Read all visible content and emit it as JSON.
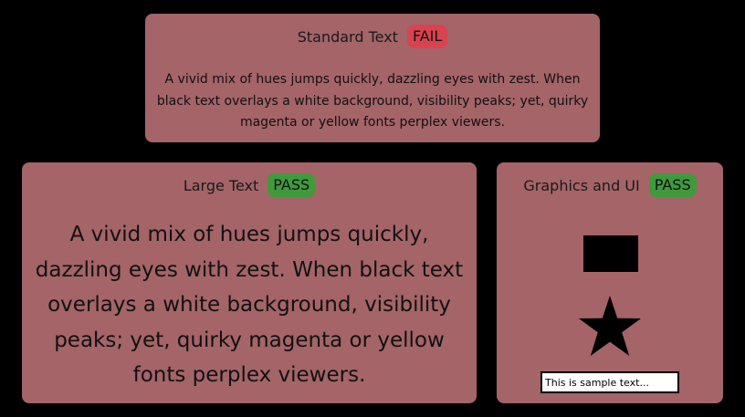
{
  "standard": {
    "title": "Standard Text",
    "status": "FAIL",
    "status_color": "#d9434f",
    "sample": "A vivid mix of hues jumps quickly, dazzling eyes with zest. When black text overlays a white background, visibility peaks; yet, quirky magenta or yellow fonts perplex viewers."
  },
  "large": {
    "title": "Large Text",
    "status": "PASS",
    "status_color": "#3f9a3c",
    "sample": "A vivid mix of hues jumps quickly, dazzling eyes with zest. When black text overlays a white background, visibility peaks; yet, quirky magenta or yellow fonts perplex viewers."
  },
  "graphics": {
    "title": "Graphics and UI",
    "status": "PASS",
    "status_color": "#3f9a3c",
    "input_value": "This is sample text..."
  },
  "colors": {
    "page_background": "#000000",
    "card_background": "#a46468",
    "foreground": "#111111"
  }
}
